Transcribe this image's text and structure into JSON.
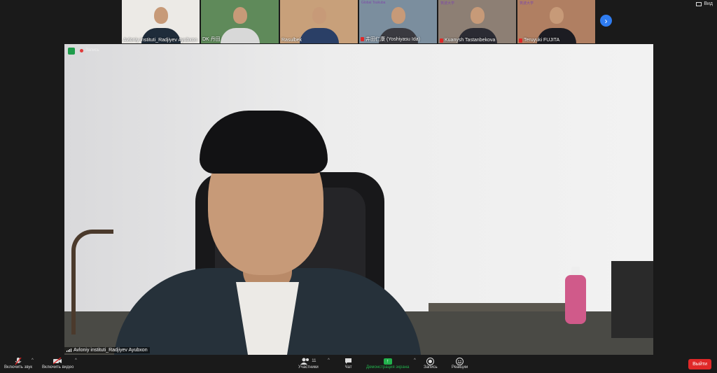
{
  "participants_strip": [
    {
      "name": "Avloniy instituti_Radjiyev Ayubxon",
      "muted": false,
      "bg": "#eceae6",
      "shirt": "#1f2c3a",
      "logo": ""
    },
    {
      "name": "DK 丹田",
      "muted": false,
      "bg": "#5f8a5a",
      "shirt": "#d8d8d8",
      "logo": ""
    },
    {
      "name": "Rasulbek",
      "muted": false,
      "bg": "#c8a07a",
      "shirt": "#2a3f66",
      "logo": ""
    },
    {
      "name": "井田仁康 (Yoshiyasu Ida)",
      "muted": true,
      "bg": "#7b8e9e",
      "shirt": "#3a3a40",
      "logo": "Global Tsukuba"
    },
    {
      "name": "Kuanysh Tastanbekova",
      "muted": true,
      "bg": "#8d7f74",
      "shirt": "#2b2b33",
      "logo": "筑波大学"
    },
    {
      "name": "Teruyuki FUJITA",
      "muted": true,
      "bg": "#b07f62",
      "shirt": "#1c1c22",
      "logo": "筑波大学"
    }
  ],
  "view_label": "Вид",
  "speaker": {
    "name": "Avloniy instituti_Radjiyev Ayubxon",
    "recording_label": "Запись"
  },
  "toolbar": {
    "unmute": "Включить звук",
    "start_video": "Включить видео",
    "participants": "Участники",
    "participants_count": "11",
    "chat": "Чат",
    "share": "Демонстрация экрана",
    "record": "Запись",
    "reactions": "Реакции",
    "leave": "Выйти"
  },
  "colors": {
    "leave": "#e02828",
    "share": "#22b14c",
    "next_button": "#2f7cf0"
  }
}
